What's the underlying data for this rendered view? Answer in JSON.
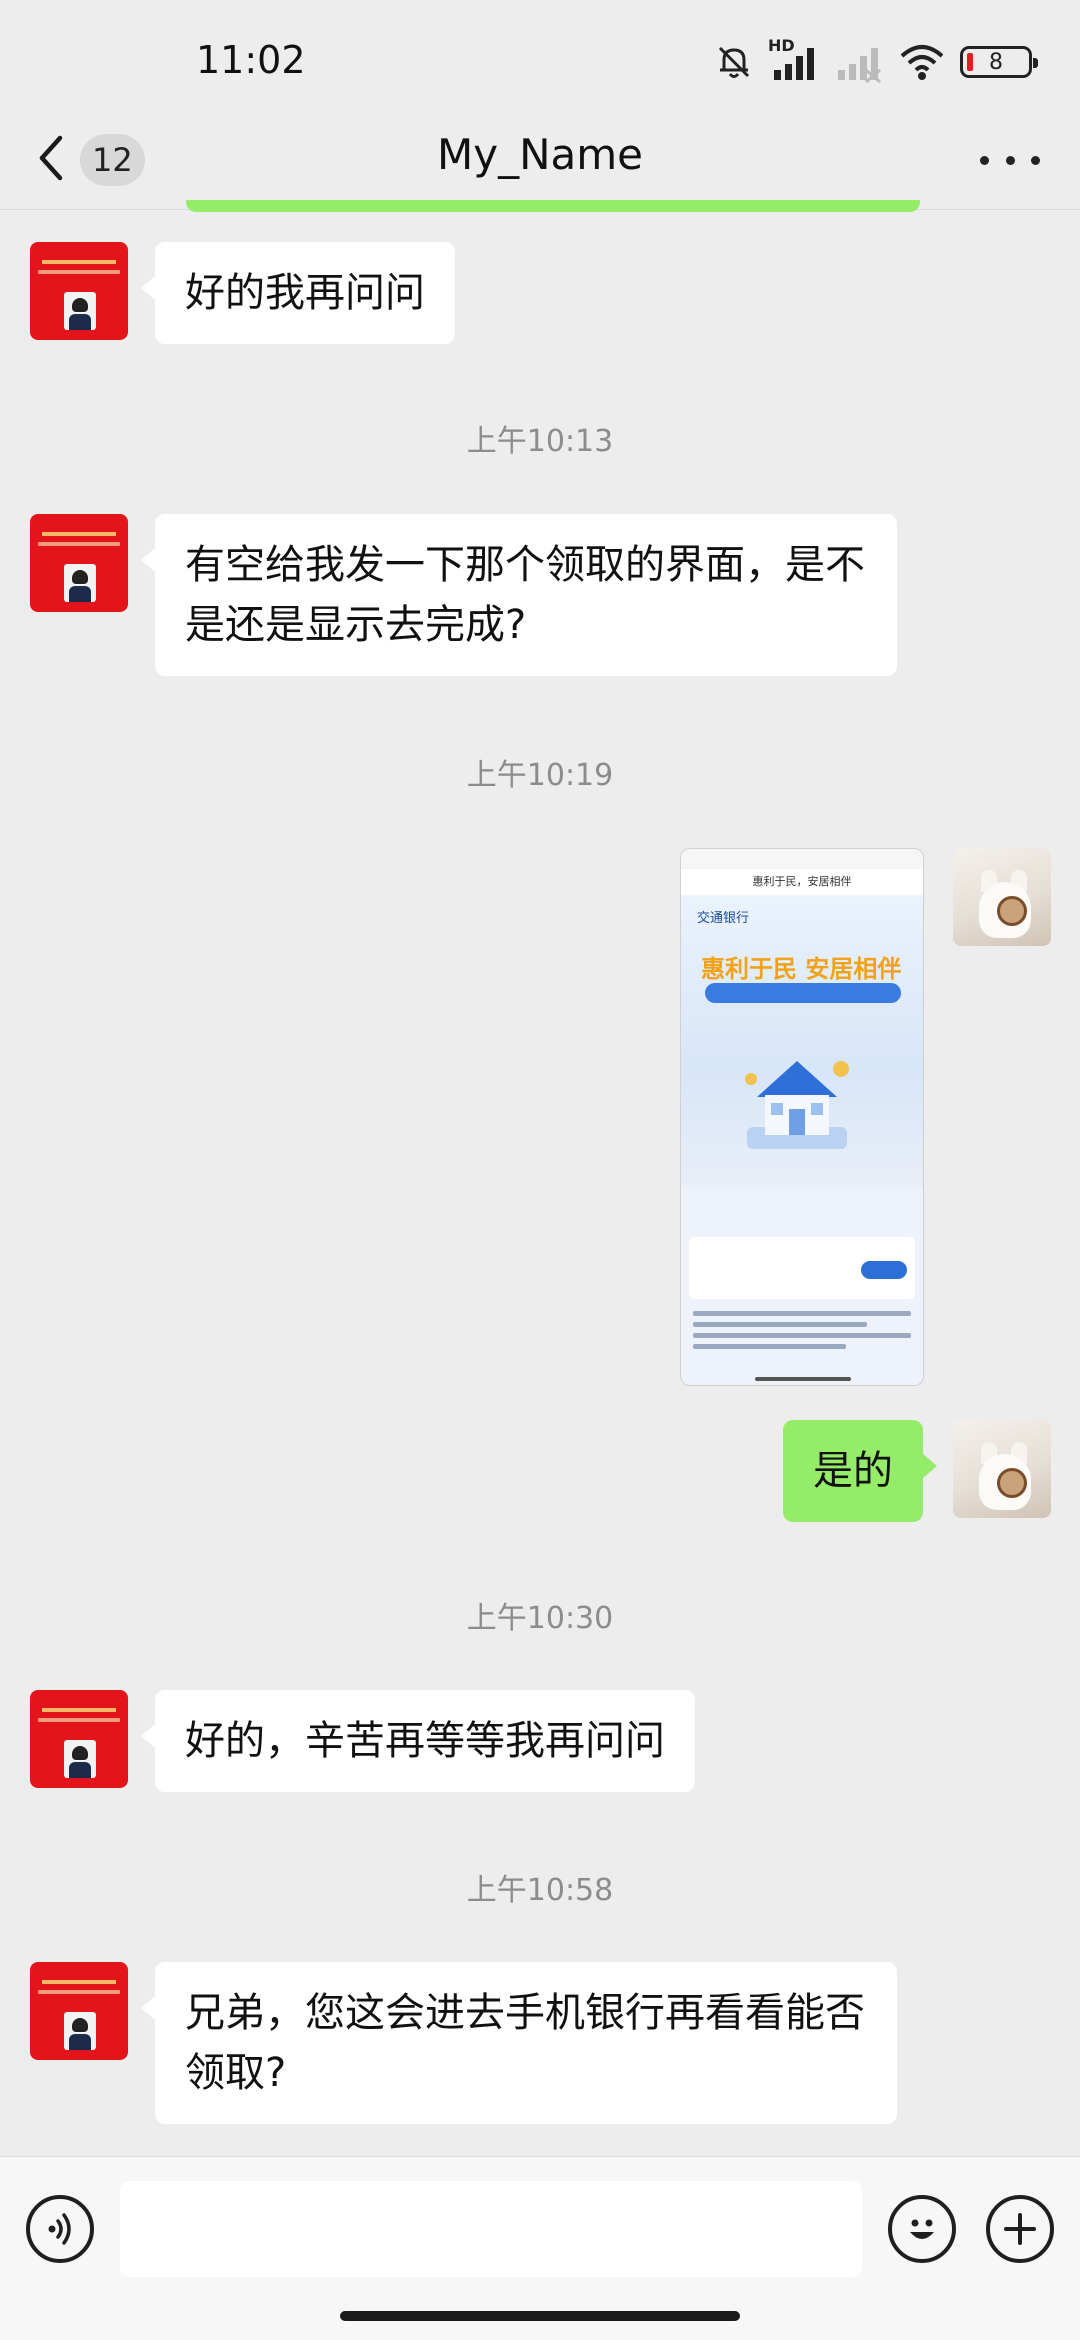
{
  "status_bar": {
    "time": "11:02",
    "network_label": "HD",
    "battery_level": "8"
  },
  "header": {
    "back_count": "12",
    "title": "My_Name",
    "more_icon": "more-horizontal-icon"
  },
  "messages": [
    {
      "type": "text",
      "side": "left",
      "text": "好的我再问问"
    },
    {
      "type": "timestamp",
      "text": "上午10:13"
    },
    {
      "type": "text",
      "side": "left",
      "text": "有空给我发一下那个领取的界面，是不是还是显示去完成?"
    },
    {
      "type": "timestamp",
      "text": "上午10:19"
    },
    {
      "type": "image",
      "side": "right",
      "nav_title": "惠利于民，安居相伴",
      "bank": "交通银行",
      "slogan": "惠利于民 安居相伴"
    },
    {
      "type": "text",
      "side": "right",
      "text": "是的"
    },
    {
      "type": "timestamp",
      "text": "上午10:30"
    },
    {
      "type": "text",
      "side": "left",
      "text": "好的，辛苦再等等我再问问"
    },
    {
      "type": "timestamp",
      "text": "上午10:58"
    },
    {
      "type": "text",
      "side": "left",
      "text": "兄弟，您这会进去手机银行再看看能否领取?"
    }
  ],
  "input_bar": {
    "voice_icon": "voice-icon",
    "placeholder": "",
    "emoji_icon": "emoji-icon",
    "plus_icon": "plus-icon"
  },
  "colors": {
    "background": "#ededed",
    "bubble_self": "#95ec69",
    "bubble_other": "#ffffff",
    "timestamp": "#8c8c8c"
  }
}
